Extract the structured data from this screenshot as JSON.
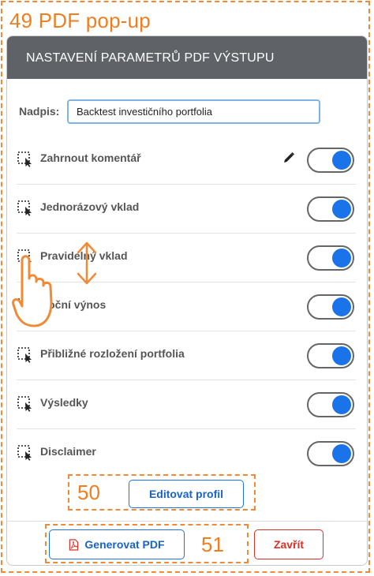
{
  "annotation": {
    "title": "49 PDF pop-up",
    "marker_50": "50",
    "marker_51": "51"
  },
  "header": {
    "title": "NASTAVENÍ PARAMETRŮ PDF VÝSTUPU"
  },
  "nadpis": {
    "label": "Nadpis:",
    "value": "Backtest investičního portfolia"
  },
  "sections": [
    {
      "label": "Zahrnout komentář",
      "enabled": true,
      "has_edit": true
    },
    {
      "label": "Jednorázový vklad",
      "enabled": true,
      "has_edit": false
    },
    {
      "label": "Pravidelný vklad",
      "enabled": true,
      "has_edit": false
    },
    {
      "label": "Roční výnos",
      "enabled": true,
      "has_edit": false
    },
    {
      "label": "Přibližné rozložení portfolia",
      "enabled": true,
      "has_edit": false
    },
    {
      "label": "Výsledky",
      "enabled": true,
      "has_edit": false
    },
    {
      "label": "Disclaimer",
      "enabled": true,
      "has_edit": false
    }
  ],
  "buttons": {
    "edit_profile": "Editovat profil",
    "generate_pdf": "Generovat PDF",
    "close": "Zavřít"
  },
  "icons": {
    "row_icon": "drag-select-icon",
    "edit_icon": "pencil-icon",
    "pdf_icon": "pdf-file-icon",
    "gesture_icon": "hand-pointer-icon",
    "arrow_icon": "vertical-double-arrow-icon"
  },
  "colors": {
    "accent": "#1a73e8",
    "annotation": "#f08a35",
    "danger": "#d93025",
    "header_bg": "#5f6368"
  }
}
